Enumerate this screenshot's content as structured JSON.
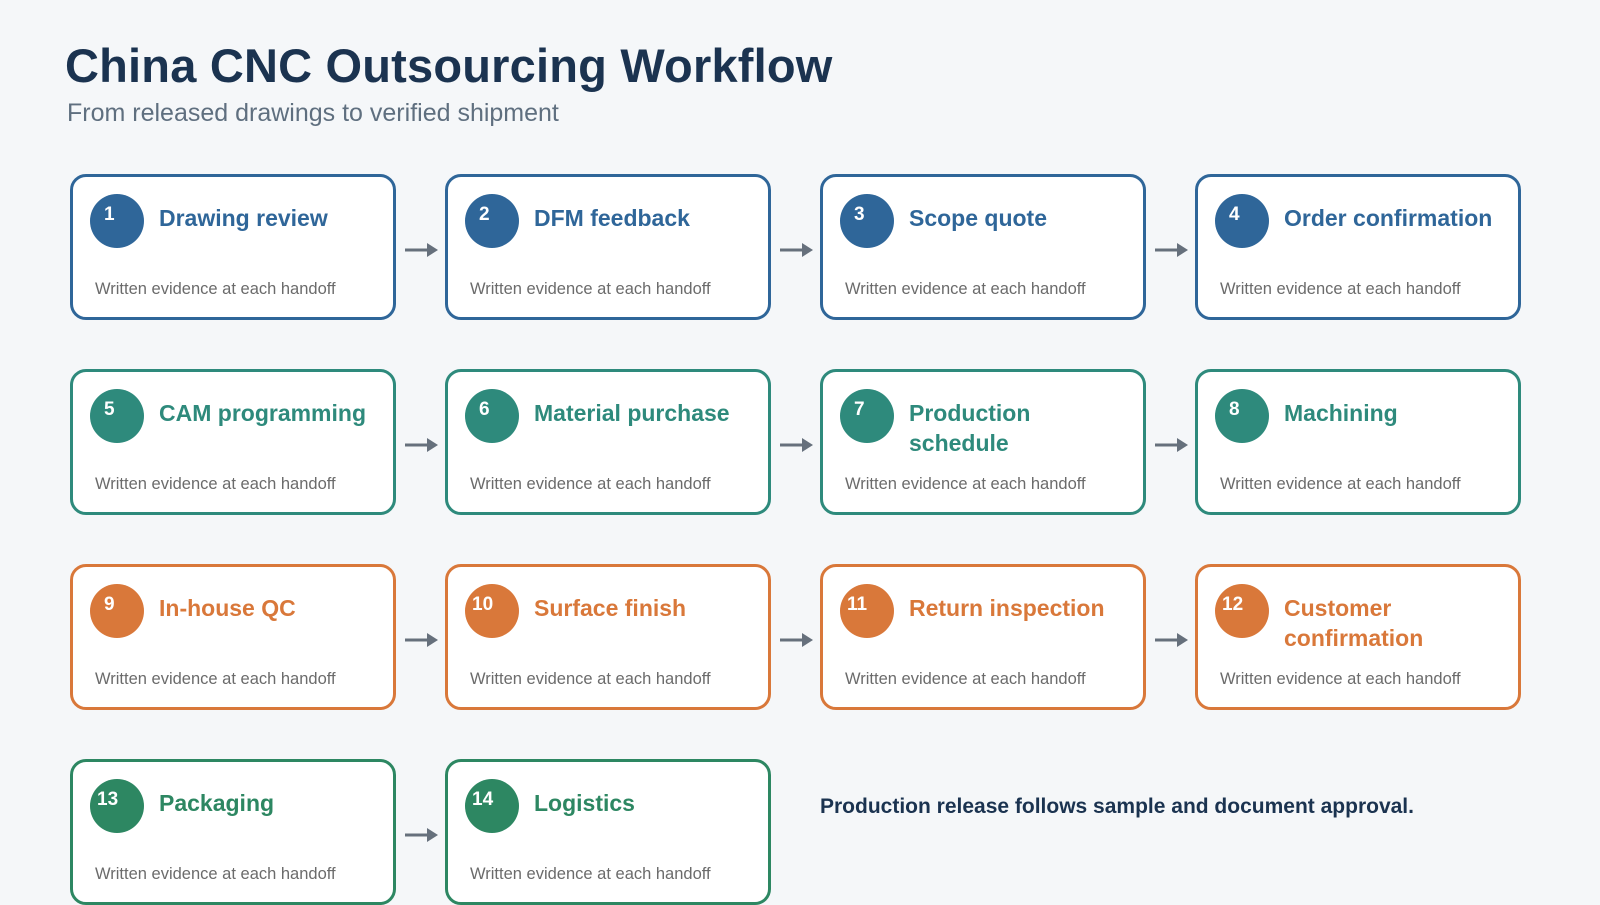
{
  "header": {
    "title": "China CNC Outsourcing Workflow",
    "subtitle": "From released drawings to verified shipment"
  },
  "steps": [
    {
      "number": "1",
      "label": "Drawing review",
      "note": "Written evidence at each handoff",
      "color": "#2f6699"
    },
    {
      "number": "2",
      "label": "DFM feedback",
      "note": "Written evidence at each handoff",
      "color": "#2f6699"
    },
    {
      "number": "3",
      "label": "Scope quote",
      "note": "Written evidence at each handoff",
      "color": "#2f6699"
    },
    {
      "number": "4",
      "label": "Order confirmation",
      "note": "Written evidence at each handoff",
      "color": "#2f6699"
    },
    {
      "number": "5",
      "label": "CAM programming",
      "note": "Written evidence at each handoff",
      "color": "#2e8a7c"
    },
    {
      "number": "6",
      "label": "Material purchase",
      "note": "Written evidence at each handoff",
      "color": "#2e8a7c"
    },
    {
      "number": "7",
      "label": "Production schedule",
      "note": "Written evidence at each handoff",
      "color": "#2e8a7c"
    },
    {
      "number": "8",
      "label": "Machining",
      "note": "Written evidence at each handoff",
      "color": "#2e8a7c"
    },
    {
      "number": "9",
      "label": "In-house QC",
      "note": "Written evidence at each handoff",
      "color": "#d9783a"
    },
    {
      "number": "10",
      "label": "Surface finish",
      "note": "Written evidence at each handoff",
      "color": "#d9783a"
    },
    {
      "number": "11",
      "label": "Return inspection",
      "note": "Written evidence at each handoff",
      "color": "#d9783a"
    },
    {
      "number": "12",
      "label": "Customer confirmation",
      "note": "Written evidence at each handoff",
      "color": "#d9783a"
    },
    {
      "number": "13",
      "label": "Packaging",
      "note": "Written evidence at each handoff",
      "color": "#2d8762"
    },
    {
      "number": "14",
      "label": "Logistics",
      "note": "Written evidence at each handoff",
      "color": "#2d8762"
    }
  ],
  "footnote": "Production release follows sample and document approval.",
  "colors": {
    "background": "#f5f7f9",
    "title": "#1b3350",
    "arrow": "#66707c"
  }
}
